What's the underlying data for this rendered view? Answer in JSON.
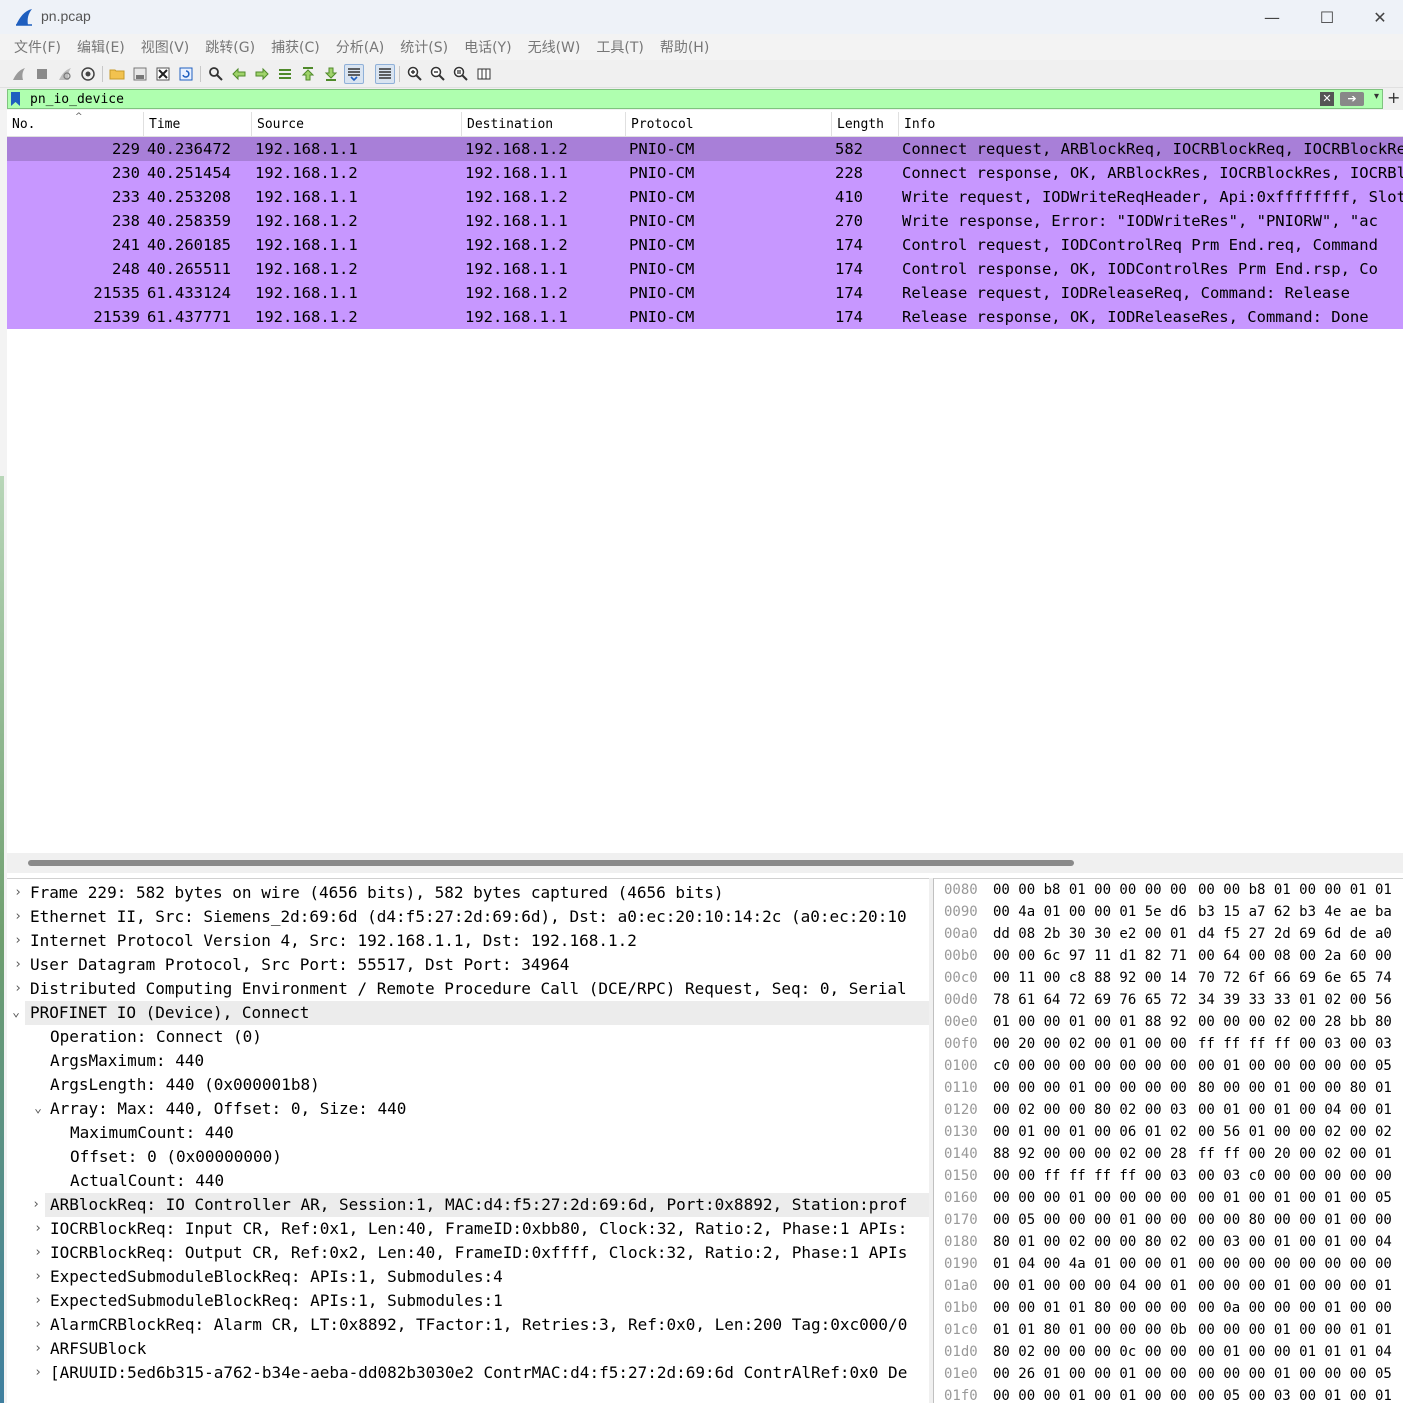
{
  "window": {
    "title": "pn.pcap",
    "minimize": "—",
    "maximize": "☐",
    "close": "✕"
  },
  "menu": [
    "文件(F)",
    "编辑(E)",
    "视图(V)",
    "跳转(G)",
    "捕获(C)",
    "分析(A)",
    "统计(S)",
    "电话(Y)",
    "无线(W)",
    "工具(T)",
    "帮助(H)"
  ],
  "toolbar": {
    "buttons": [
      "start-capture-icon",
      "stop-capture-icon",
      "restart-capture-icon",
      "capture-options-icon",
      "open-file-icon",
      "save-file-icon",
      "close-file-icon",
      "reload-file-icon",
      "find-packet-icon",
      "go-back-icon",
      "go-forward-icon",
      "go-to-packet-icon",
      "go-first-icon",
      "go-last-icon",
      "autoscroll-icon",
      "colorize-icon",
      "zoom-in-icon",
      "zoom-out-icon",
      "zoom-reset-icon",
      "resize-columns-icon"
    ]
  },
  "filter": {
    "value": "pn_io_device",
    "add_label": "+"
  },
  "packet_list": {
    "columns": [
      "No.",
      "Time",
      "Source",
      "Destination",
      "Protocol",
      "Length",
      "Info"
    ],
    "rows": [
      {
        "no": "229",
        "time": "40.236472",
        "src": "192.168.1.1",
        "dst": "192.168.1.2",
        "proto": "PNIO-CM",
        "len": "582",
        "info": "Connect request, ARBlockReq, IOCRBlockReq, IOCRBlockReq, ExpectedSubmoduleBlockReq"
      },
      {
        "no": "230",
        "time": "40.251454",
        "src": "192.168.1.2",
        "dst": "192.168.1.1",
        "proto": "PNIO-CM",
        "len": "228",
        "info": "Connect response, OK, ARBlockRes, IOCRBlockRes, IOCRBlockRes"
      },
      {
        "no": "233",
        "time": "40.253208",
        "src": "192.168.1.1",
        "dst": "192.168.1.2",
        "proto": "PNIO-CM",
        "len": "410",
        "info": "Write request, IODWriteReqHeader, Api:0xffffffff, Slot"
      },
      {
        "no": "238",
        "time": "40.258359",
        "src": "192.168.1.2",
        "dst": "192.168.1.1",
        "proto": "PNIO-CM",
        "len": "270",
        "info": "Write response, Error: \"IODWriteRes\", \"PNIORW\", \"ac"
      },
      {
        "no": "241",
        "time": "40.260185",
        "src": "192.168.1.1",
        "dst": "192.168.1.2",
        "proto": "PNIO-CM",
        "len": "174",
        "info": "Control request, IODControlReq Prm End.req, Command"
      },
      {
        "no": "248",
        "time": "40.265511",
        "src": "192.168.1.2",
        "dst": "192.168.1.1",
        "proto": "PNIO-CM",
        "len": "174",
        "info": "Control response, OK, IODControlRes Prm End.rsp, Co"
      },
      {
        "no": "21535",
        "time": "61.433124",
        "src": "192.168.1.1",
        "dst": "192.168.1.2",
        "proto": "PNIO-CM",
        "len": "174",
        "info": "Release request, IODReleaseReq, Command: Release"
      },
      {
        "no": "21539",
        "time": "61.437771",
        "src": "192.168.1.2",
        "dst": "192.168.1.1",
        "proto": "PNIO-CM",
        "len": "174",
        "info": "Release response, OK, IODReleaseRes, Command: Done"
      }
    ]
  },
  "details": [
    {
      "arrow": "›",
      "indent": 0,
      "text": "Frame 229: 582 bytes on wire (4656 bits), 582 bytes captured (4656 bits)",
      "hl": false
    },
    {
      "arrow": "›",
      "indent": 0,
      "text": "Ethernet II, Src: Siemens_2d:69:6d (d4:f5:27:2d:69:6d), Dst: a0:ec:20:10:14:2c (a0:ec:20:10",
      "hl": false
    },
    {
      "arrow": "›",
      "indent": 0,
      "text": "Internet Protocol Version 4, Src: 192.168.1.1, Dst: 192.168.1.2",
      "hl": false
    },
    {
      "arrow": "›",
      "indent": 0,
      "text": "User Datagram Protocol, Src Port: 55517, Dst Port: 34964",
      "hl": false
    },
    {
      "arrow": "›",
      "indent": 0,
      "text": "Distributed Computing Environment / Remote Procedure Call (DCE/RPC) Request, Seq: 0, Serial",
      "hl": false
    },
    {
      "arrow": "⌄",
      "indent": 0,
      "text": "PROFINET IO (Device), Connect",
      "hl": true
    },
    {
      "arrow": "",
      "indent": 1,
      "text": "Operation: Connect (0)",
      "hl": false
    },
    {
      "arrow": "",
      "indent": 1,
      "text": "ArgsMaximum: 440",
      "hl": false
    },
    {
      "arrow": "",
      "indent": 1,
      "text": "ArgsLength: 440 (0x000001b8)",
      "hl": false
    },
    {
      "arrow": "⌄",
      "indent": 1,
      "text": "Array: Max: 440, Offset: 0, Size: 440",
      "hl": false
    },
    {
      "arrow": "",
      "indent": 2,
      "text": "MaximumCount: 440",
      "hl": false
    },
    {
      "arrow": "",
      "indent": 2,
      "text": "Offset: 0 (0x00000000)",
      "hl": false
    },
    {
      "arrow": "",
      "indent": 2,
      "text": "ActualCount: 440",
      "hl": false
    },
    {
      "arrow": "›",
      "indent": 1,
      "text": "ARBlockReq: IO Controller AR, Session:1, MAC:d4:f5:27:2d:69:6d, Port:0x8892, Station:prof",
      "hl": true
    },
    {
      "arrow": "›",
      "indent": 1,
      "text": "IOCRBlockReq: Input CR, Ref:0x1, Len:40, FrameID:0xbb80, Clock:32, Ratio:2, Phase:1 APIs:",
      "hl": false
    },
    {
      "arrow": "›",
      "indent": 1,
      "text": "IOCRBlockReq: Output CR, Ref:0x2, Len:40, FrameID:0xffff, Clock:32, Ratio:2, Phase:1 APIs",
      "hl": false
    },
    {
      "arrow": "›",
      "indent": 1,
      "text": "ExpectedSubmoduleBlockReq: APIs:1, Submodules:4",
      "hl": false
    },
    {
      "arrow": "›",
      "indent": 1,
      "text": "ExpectedSubmoduleBlockReq: APIs:1, Submodules:1",
      "hl": false
    },
    {
      "arrow": "›",
      "indent": 1,
      "text": "AlarmCRBlockReq: Alarm CR, LT:0x8892, TFactor:1, Retries:3, Ref:0x0, Len:200 Tag:0xc000/0",
      "hl": false
    },
    {
      "arrow": "›",
      "indent": 1,
      "text": "ARFSUBlock",
      "hl": false
    },
    {
      "arrow": "›",
      "indent": 1,
      "text": "[ARUUID:5ed6b315-a762-b34e-aeba-dd082b3030e2 ContrMAC:d4:f5:27:2d:69:6d ContrAlRef:0x0 De",
      "hl": false
    }
  ],
  "bytes": [
    {
      "off": "0080",
      "h1": "00 00 b8 01 00 00 00 00",
      "h2": "00 00 b8 01 00 00 01 01"
    },
    {
      "off": "0090",
      "h1": "00 4a 01 00 00 01 5e d6",
      "h2": "b3 15 a7 62 b3 4e ae ba"
    },
    {
      "off": "00a0",
      "h1": "dd 08 2b 30 30 e2 00 01",
      "h2": "d4 f5 27 2d 69 6d de a0"
    },
    {
      "off": "00b0",
      "h1": "00 00 6c 97 11 d1 82 71",
      "h2": "00 64 00 08 00 2a 60 00"
    },
    {
      "off": "00c0",
      "h1": "00 11 00 c8 88 92 00 14",
      "h2": "70 72 6f 66 69 6e 65 74"
    },
    {
      "off": "00d0",
      "h1": "78 61 64 72 69 76 65 72",
      "h2": "34 39 33 33 01 02 00 56"
    },
    {
      "off": "00e0",
      "h1": "01 00 00 01 00 01 88 92",
      "h2": "00 00 00 02 00 28 bb 80"
    },
    {
      "off": "00f0",
      "h1": "00 20 00 02 00 01 00 00",
      "h2": "ff ff ff ff 00 03 00 03"
    },
    {
      "off": "0100",
      "h1": "c0 00 00 00 00 00 00 00",
      "h2": "00 01 00 00 00 00 00 05"
    },
    {
      "off": "0110",
      "h1": "00 00 00 01 00 00 00 00",
      "h2": "80 00 00 01 00 00 80 01"
    },
    {
      "off": "0120",
      "h1": "00 02 00 00 80 02 00 03",
      "h2": "00 01 00 01 00 04 00 01"
    },
    {
      "off": "0130",
      "h1": "00 01 00 01 00 06 01 02",
      "h2": "00 56 01 00 00 02 00 02"
    },
    {
      "off": "0140",
      "h1": "88 92 00 00 00 02 00 28",
      "h2": "ff ff 00 20 00 02 00 01"
    },
    {
      "off": "0150",
      "h1": "00 00 ff ff ff ff 00 03",
      "h2": "00 03 c0 00 00 00 00 00"
    },
    {
      "off": "0160",
      "h1": "00 00 00 01 00 00 00 00",
      "h2": "00 01 00 01 00 01 00 05"
    },
    {
      "off": "0170",
      "h1": "00 05 00 00 00 01 00 00",
      "h2": "00 00 80 00 00 01 00 00"
    },
    {
      "off": "0180",
      "h1": "80 01 00 02 00 00 80 02",
      "h2": "00 03 00 01 00 01 00 04"
    },
    {
      "off": "0190",
      "h1": "01 04 00 4a 01 00 00 01",
      "h2": "00 00 00 00 00 00 00 00"
    },
    {
      "off": "01a0",
      "h1": "00 01 00 00 00 04 00 01",
      "h2": "00 00 00 01 00 00 00 01"
    },
    {
      "off": "01b0",
      "h1": "00 00 01 01 80 00 00 00",
      "h2": "00 0a 00 00 00 01 00 00"
    },
    {
      "off": "01c0",
      "h1": "01 01 80 01 00 00 00 0b",
      "h2": "00 00 00 01 00 00 01 01"
    },
    {
      "off": "01d0",
      "h1": "80 02 00 00 00 0c 00 00",
      "h2": "00 01 00 00 01 01 01 04"
    },
    {
      "off": "01e0",
      "h1": "00 26 01 00 00 01 00 00",
      "h2": "00 00 00 01 00 00 00 05"
    },
    {
      "off": "01f0",
      "h1": "00 00 00 01 00 01 00 00",
      "h2": "00 05 00 03 00 01 00 01"
    }
  ]
}
